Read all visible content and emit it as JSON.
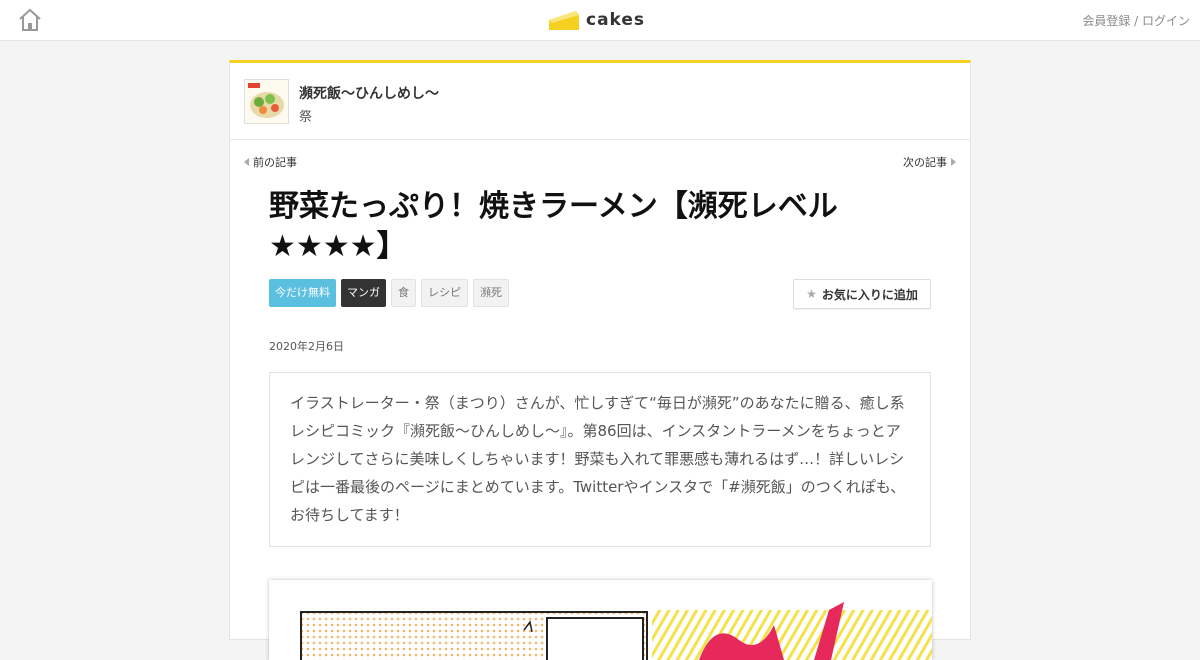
{
  "header": {
    "logo_text": "cakes",
    "auth_text": "会員登録 / ログイン",
    "home_icon": "home-icon",
    "accent_color": "#f5d020"
  },
  "series": {
    "title": "瀕死飯～ひんしめし～",
    "author": "祭"
  },
  "nav": {
    "prev_label": "前の記事",
    "next_label": "次の記事"
  },
  "article": {
    "title": "野菜たっぷり！焼きラーメン【瀕死レベル★★★★】",
    "tags": [
      {
        "label": "今だけ無料",
        "color": "#5bbfe0"
      },
      {
        "label": "マンガ",
        "color": "#333333"
      },
      {
        "label": "食"
      },
      {
        "label": "レシピ"
      },
      {
        "label": "瀕死"
      }
    ],
    "favorite_label": "お気に入りに追加",
    "date": "2020年2月6日",
    "lead": "イラストレーター・祭（まつり）さんが、忙しすぎて“毎日が瀕死”のあなたに贈る、癒し系レシピコミック『瀕死飯～ひんしめし～』。第86回は、インスタントラーメンをちょっとアレンジしてさらに美味しくしちゃいます！野菜も入れて罪悪感も薄れるはず…！詳しいレシピは一番最後のページにまとめています。Twitterやインスタで「#瀕死飯」のつくれぽも、お待ちしてます！"
  }
}
